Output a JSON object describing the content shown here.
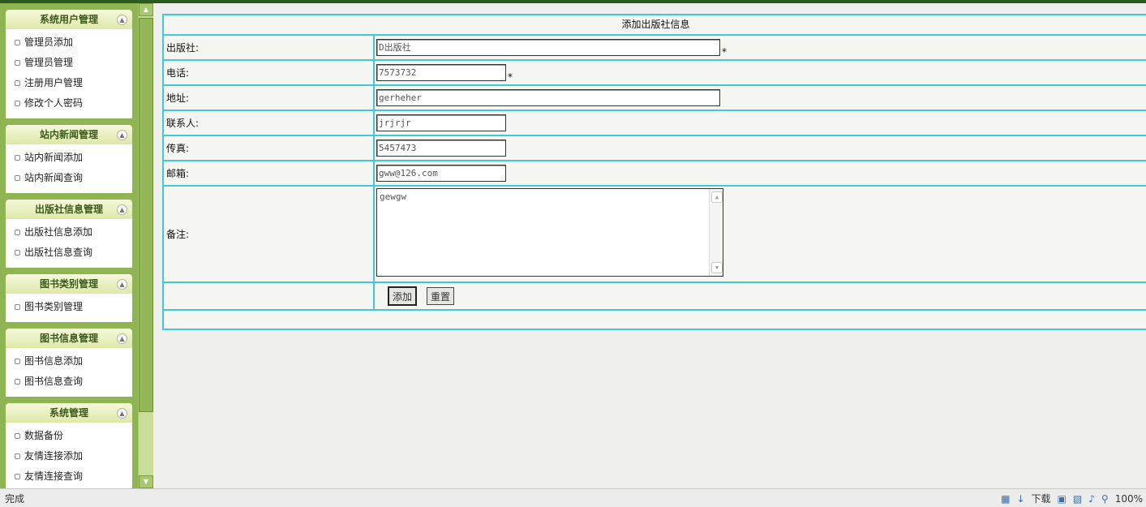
{
  "sidebar": {
    "groups": [
      {
        "title": "系统用户管理",
        "items": [
          "管理员添加",
          "管理员管理",
          "注册用户管理",
          "修改个人密码"
        ]
      },
      {
        "title": "站内新闻管理",
        "items": [
          "站内新闻添加",
          "站内新闻查询"
        ]
      },
      {
        "title": "出版社信息管理",
        "items": [
          "出版社信息添加",
          "出版社信息查询"
        ]
      },
      {
        "title": "图书类别管理",
        "items": [
          "图书类别管理"
        ]
      },
      {
        "title": "图书信息管理",
        "items": [
          "图书信息添加",
          "图书信息查询"
        ]
      },
      {
        "title": "系统管理",
        "items": [
          "数据备份",
          "友情连接添加",
          "友情连接查询"
        ]
      }
    ]
  },
  "form": {
    "title": "添加出版社信息",
    "fields": {
      "publisher": {
        "label": "出版社:",
        "value": "D出版社",
        "required_mark": "*"
      },
      "phone": {
        "label": "电话:",
        "value": "7573732",
        "required_mark": "*"
      },
      "address": {
        "label": "地址:",
        "value": "gerheher"
      },
      "contact": {
        "label": "联系人:",
        "value": "jrjrjr"
      },
      "fax": {
        "label": "传真:",
        "value": "5457473"
      },
      "email": {
        "label": "邮箱:",
        "value": "gww@126.com"
      },
      "remark": {
        "label": "备注:",
        "value": "gewgw"
      }
    },
    "buttons": {
      "add": "添加",
      "reset": "重置"
    }
  },
  "statusbar": {
    "status": "完成",
    "download": "下载",
    "zoom": "100%"
  }
}
